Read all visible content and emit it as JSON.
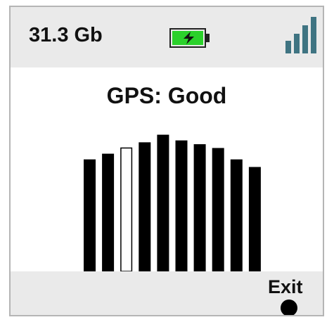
{
  "status_bar": {
    "storage": "31.3 Gb",
    "battery_icon": "battery-charging-icon",
    "battery_color": "#2bd12b",
    "signal_icon": "signal-bars-icon",
    "signal_color": "#3f7482"
  },
  "main": {
    "gps_status": "GPS: Good",
    "signal_bars": {
      "values": [
        0.59,
        0.62,
        0.65,
        0.68,
        0.72,
        0.69,
        0.67,
        0.65,
        0.59,
        0.55
      ],
      "highlighted_index": 2
    }
  },
  "footer": {
    "exit_label": "Exit",
    "exit_icon": "exit-dot-icon"
  }
}
